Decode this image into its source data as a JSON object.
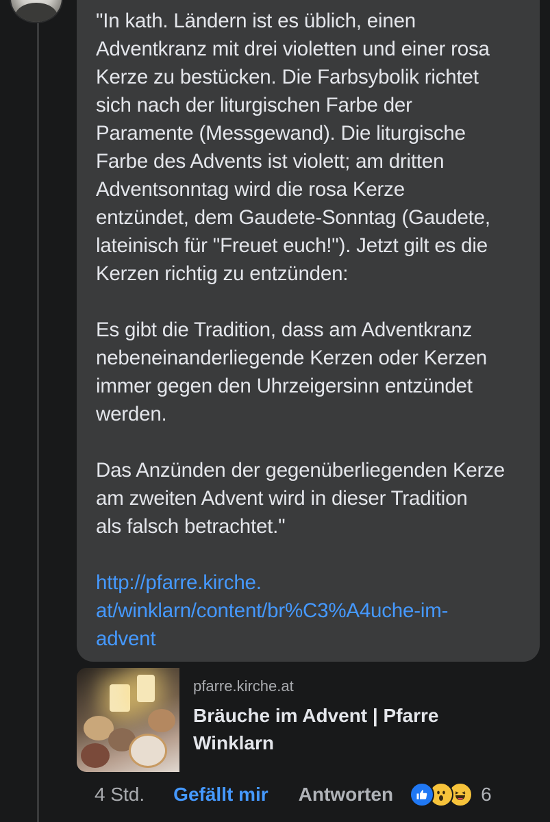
{
  "comment": {
    "paragraphs": [
      "\"In kath. Ländern ist es üblich, einen\nAdventkranz mit drei violetten und einer rosa\nKerze zu bestücken. Die Farbsybolik richtet\nsich nach der liturgischen Farbe der\nParamente (Messgewand). Die liturgische\nFarbe des Advents ist violett; am dritten\nAdventsonntag wird die rosa Kerze\nentzündet, dem Gaudete-Sonntag (Gaudete,\nlateinisch für \"Freuet euch!\"). Jetzt gilt es die\nKerzen richtig zu entzünden:",
      "Es gibt die Tradition, dass am Adventkranz\nnebeneinanderliegende Kerzen oder Kerzen\nimmer gegen den Uhrzeigersinn entzündet\nwerden.",
      "Das Anzünden der gegenüberliegenden Kerze\nam zweiten Advent wird in dieser Tradition\nals falsch betrachtet.\""
    ],
    "link_text": "http://pfarre.kirche.\nat/winklarn/content/br%C3%A4uche-im-\nadvent"
  },
  "preview": {
    "domain": "pfarre.kirche.at",
    "title": "Bräuche im Advent | Pfarre Winklarn"
  },
  "actions": {
    "time": "4 Std.",
    "like_label": "Gefällt mir",
    "reply_label": "Antworten",
    "reaction_count": "6"
  },
  "reactions": [
    "like-icon",
    "wow-icon",
    "haha-icon"
  ],
  "colors": {
    "background": "#18191a",
    "bubble": "#3a3b3c",
    "link": "#4599ff",
    "text": "#e4e6eb",
    "muted": "#a9abaf"
  }
}
